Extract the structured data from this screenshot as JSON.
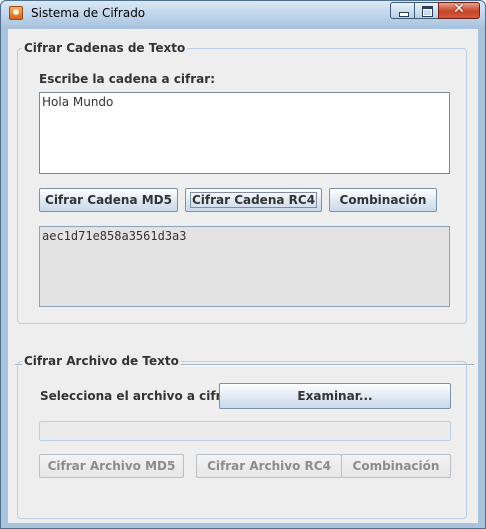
{
  "window": {
    "title": "Sistema de Cifrado"
  },
  "strings_section": {
    "legend": "Cifrar Cadenas de Texto",
    "input_label": "Escribe la cadena a cifrar:",
    "input_value": "Hola Mundo",
    "buttons": {
      "md5": "Cifrar Cadena MD5",
      "rc4": "Cifrar Cadena RC4",
      "combo": "Combinación"
    },
    "output_value": "aec1d71e858a3561d3a3"
  },
  "file_section": {
    "legend": "Cifrar Archivo de Texto",
    "select_label": "Selecciona el archivo a cifrar:",
    "browse_button": "Examinar...",
    "progress_value": 0,
    "buttons": {
      "md5": "Cifrar Archivo MD5",
      "rc4": "Cifrar Archivo RC4",
      "combo": "Combinación"
    }
  },
  "colors": {
    "accent": "#a9c3dd",
    "panel": "#eeeeee",
    "border": "#b8cfe5"
  },
  "icons": [
    "app-icon",
    "minimize-icon",
    "maximize-icon",
    "close-icon"
  ]
}
